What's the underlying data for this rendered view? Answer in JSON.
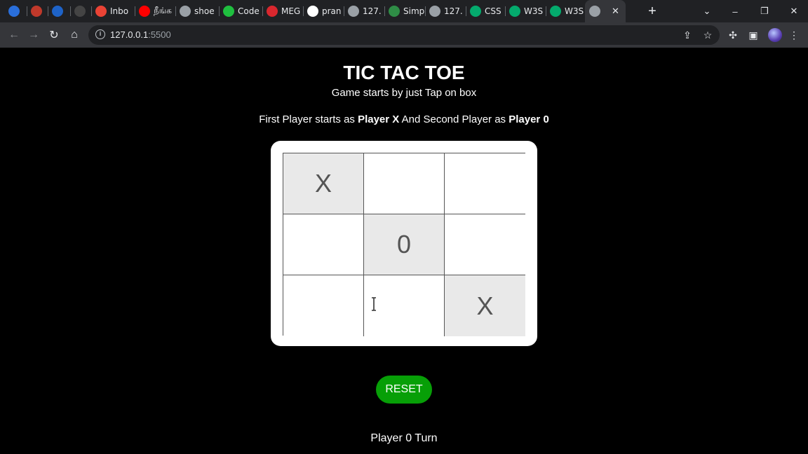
{
  "browser": {
    "tabs": [
      {
        "label": "",
        "icon": "edge-icon",
        "color": "#2a6fdb"
      },
      {
        "label": "",
        "icon": "red-x-icon",
        "color": "#c0392b"
      },
      {
        "label": "",
        "icon": "blue-globe-icon",
        "color": "#1e63c8"
      },
      {
        "label": "",
        "icon": "m-logo-icon",
        "color": "#444"
      },
      {
        "label": "Inbo",
        "icon": "gmail-icon",
        "color": "#ea4335"
      },
      {
        "label": "நீங்க",
        "icon": "youtube-icon",
        "color": "#ff0000"
      },
      {
        "label": "shoe",
        "icon": "globe-icon",
        "color": "#9aa0a6"
      },
      {
        "label": "Code",
        "icon": "green-asterisk-icon",
        "color": "#1fbf3f"
      },
      {
        "label": "MEG",
        "icon": "mega-icon",
        "color": "#d9272e"
      },
      {
        "label": "pran",
        "icon": "github-icon",
        "color": "#ffffff"
      },
      {
        "label": "127.",
        "icon": "globe-icon",
        "color": "#9aa0a6"
      },
      {
        "label": "Simp",
        "icon": "gfg-icon",
        "color": "#2f8d46"
      },
      {
        "label": "127.",
        "icon": "globe-icon",
        "color": "#9aa0a6"
      },
      {
        "label": "CSS",
        "icon": "w3schools-icon",
        "color": "#04aa6d"
      },
      {
        "label": "W3S",
        "icon": "w3schools-icon",
        "color": "#04aa6d"
      },
      {
        "label": "W3S",
        "icon": "w3schools-icon",
        "color": "#04aa6d"
      },
      {
        "label": "",
        "icon": "globe-icon",
        "color": "#9aa0a6",
        "active": true
      }
    ],
    "url_host": "127.0.0.1",
    "url_port": ":5500"
  },
  "game": {
    "title": "TIC TAC TOE",
    "subtitle": "Game starts by just Tap on box",
    "players_prefix": "First Player starts as ",
    "player1": "Player X",
    "players_middle": " And Second Player as ",
    "player2": "Player 0",
    "board": [
      "X",
      "",
      "",
      "",
      "0",
      "",
      "",
      "",
      "X"
    ],
    "reset_label": "RESET",
    "turn_text": "Player 0 Turn",
    "accent": "#079f07"
  }
}
